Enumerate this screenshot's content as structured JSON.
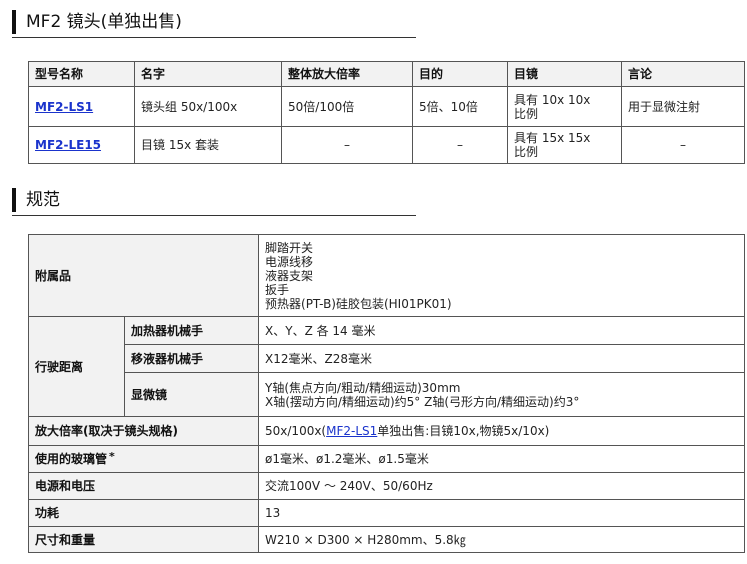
{
  "section1": {
    "title": "MF2 镜头(单独出售)"
  },
  "product_table": {
    "headers": [
      "型号名称",
      "名字",
      "整体放大倍率",
      "目的",
      "目镜",
      "言论"
    ],
    "rows": [
      {
        "model": "MF2-LS1",
        "name": "镜头组 50x/100x",
        "magnification": "50倍/100倍",
        "objective": "5倍、10倍",
        "eyepiece": [
          "具有 10x 10x",
          "比例"
        ],
        "remarks": "用于显微注射"
      },
      {
        "model": "MF2-LE15",
        "name": "目镜 15x 套装",
        "magnification": "–",
        "objective": "–",
        "eyepiece": [
          "具有 15x 15x",
          "比例"
        ],
        "remarks": "–"
      }
    ]
  },
  "section2": {
    "title": "规范"
  },
  "spec_table": {
    "accessories": {
      "label": "附属品",
      "items": [
        "脚踏开关",
        "电源线移",
        "液器支架",
        "扳手",
        "预热器(PT-B)硅胶包装(HI01PK01)"
      ]
    },
    "travel": {
      "label": "行驶距离",
      "heater_arm": {
        "label": "加热器机械手",
        "value": "X、Y、Z 各 14 毫米"
      },
      "pipette_arm": {
        "label": "移液器机械手",
        "value": "X12毫米、Z28毫米"
      },
      "microscope": {
        "label": "显微镜",
        "line1": "Y轴(焦点方向/粗动/精细运动)30mm",
        "line2": "X轴(摆动方向/精细运动)约5°  Z轴(弓形方向/精细运动)约3°"
      }
    },
    "magnification": {
      "label": "放大倍率(取决于镜头规格)",
      "prefix": "50x/100x(",
      "link": "MF2-LS1",
      "suffix": "单独出售:目镜10x,物镜5x/10x)"
    },
    "glass_tube": {
      "label": "使用的玻璃管",
      "star": "*",
      "value": "ø1毫米、ø1.2毫米、ø1.5毫米"
    },
    "power_voltage": {
      "label": "电源和电压",
      "value": "交流100V ～ 240V、50/60Hz"
    },
    "power_consumption": {
      "label": "功耗",
      "value": "13"
    },
    "size_weight": {
      "label": "尺寸和重量",
      "value": "W210 × D300 × H280mm、5.8㎏"
    }
  }
}
